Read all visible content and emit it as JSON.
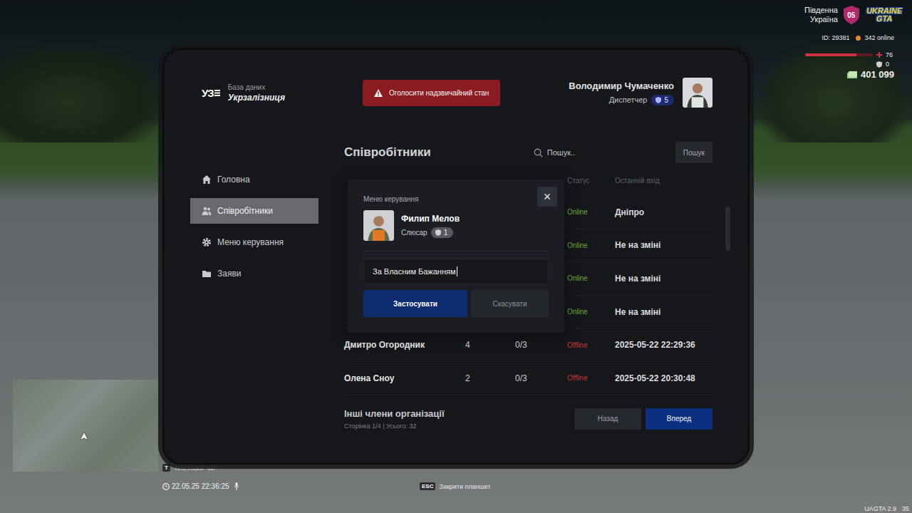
{
  "hud": {
    "region": [
      "Південна",
      "Україна"
    ],
    "region_badge": "05",
    "logo": [
      "UKRAINE",
      "GTA"
    ],
    "player_id": "ID: 29381",
    "online": "342 online",
    "health": {
      "reading": "76",
      "level": 0.76
    },
    "armor": {
      "reading": "0"
    },
    "money": "401 099"
  },
  "tablet": {
    "logo": "УЗ",
    "db_label": "База даних",
    "org_name": "Укрзалізниця",
    "emergency_button": "Оголосити надзвичайний стан",
    "user": {
      "name": "Володимир Чумаченко",
      "role": "Диспетчер",
      "rank": "5"
    }
  },
  "sidebar": {
    "items": [
      {
        "label": "Головна",
        "selected": false
      },
      {
        "label": "Співробітники",
        "selected": true
      },
      {
        "label": "Меню керування",
        "selected": false
      },
      {
        "label": "Заяви",
        "selected": false
      }
    ]
  },
  "page": {
    "title": "Співробітники",
    "search": {
      "placeholder": "Пошук..",
      "button": "Пошук"
    }
  },
  "table": {
    "columns": [
      "",
      "",
      "",
      "Статус",
      "Останній вхід"
    ],
    "rows": [
      {
        "cells": [
          "",
          "",
          "",
          "Online",
          "Дніпро"
        ],
        "online": true
      },
      {
        "cells": [
          "",
          "",
          "",
          "Online",
          "Не на зміні"
        ],
        "online": true
      },
      {
        "cells": [
          "",
          "",
          "",
          "Online",
          "Не на зміні"
        ],
        "online": true
      },
      {
        "cells": [
          "",
          "",
          "",
          "Online",
          "Не на зміні"
        ],
        "online": true
      },
      {
        "cells": [
          "Дмитро Огородник",
          "4",
          "0/3",
          "Offline",
          "2025-05-22 22:29:36"
        ],
        "online": false
      },
      {
        "cells": [
          "Олена Сноу",
          "2",
          "0/3",
          "Offline",
          "2025-05-22 20:30:48"
        ],
        "online": false
      }
    ]
  },
  "pagination": {
    "title": "Інші члени організації",
    "info": "Сторінка 1/4 | Усього: 32",
    "buttons": [
      {
        "label": "Назад",
        "primary": false
      },
      {
        "label": "Вперед",
        "primary": true
      }
    ]
  },
  "modal": {
    "title": "Меню керування",
    "close": "×",
    "employee": {
      "name": "Филип Мелов",
      "role": "Слюсар",
      "rank": "1"
    },
    "reason": "За Власним Бажанням",
    "buttons": [
      {
        "label": "Застосувати",
        "primary": true
      },
      {
        "label": "Скасувати",
        "primary": false
      }
    ]
  },
  "chat": {
    "key": "T",
    "label": "Текстовий чат"
  },
  "clock": "22.05.25 22:36:25",
  "hint": {
    "key": "ESC",
    "label": "Закрити планшет"
  },
  "version": "UAGTA 2.9",
  "fps": "35"
}
